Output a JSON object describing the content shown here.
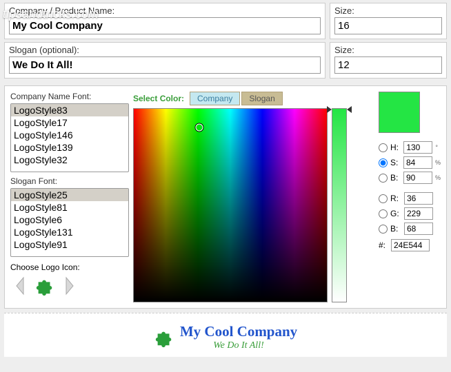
{
  "watermark": "tipsandtricks.com",
  "fields": {
    "company_label": "Company / Product Name:",
    "company_value": "My Cool Company",
    "slogan_label": "Slogan (optional):",
    "slogan_value": "We Do It All!",
    "size1_label": "Size:",
    "size1_value": "16",
    "size2_label": "Size:",
    "size2_value": "12"
  },
  "fonts": {
    "company_label": "Company Name Font:",
    "company_list": [
      "LogoStyle83",
      "LogoStyle17",
      "LogoStyle146",
      "LogoStyle139",
      "LogoStyle32"
    ],
    "company_selected": "LogoStyle83",
    "slogan_label": "Slogan Font:",
    "slogan_list": [
      "LogoStyle25",
      "LogoStyle81",
      "LogoStyle6",
      "LogoStyle131",
      "LogoStyle91"
    ],
    "slogan_selected": "LogoStyle25"
  },
  "icon_label": "Choose Logo Icon:",
  "color": {
    "select_label": "Select Color:",
    "tabs": {
      "company": "Company",
      "slogan": "Slogan"
    },
    "h_label": "H:",
    "h_value": "130",
    "h_unit": "°",
    "s_label": "S:",
    "s_value": "84",
    "s_unit": "%",
    "b_label": "B:",
    "b_value": "90",
    "b_unit": "%",
    "r_label": "R:",
    "r_value": "36",
    "g_label": "G:",
    "g_value": "229",
    "bl_label": "B:",
    "bl_value": "68",
    "hex_label": "#:",
    "hex_value": "24E544"
  },
  "preview": {
    "company": "My Cool Company",
    "slogan": "We Do It All!"
  }
}
